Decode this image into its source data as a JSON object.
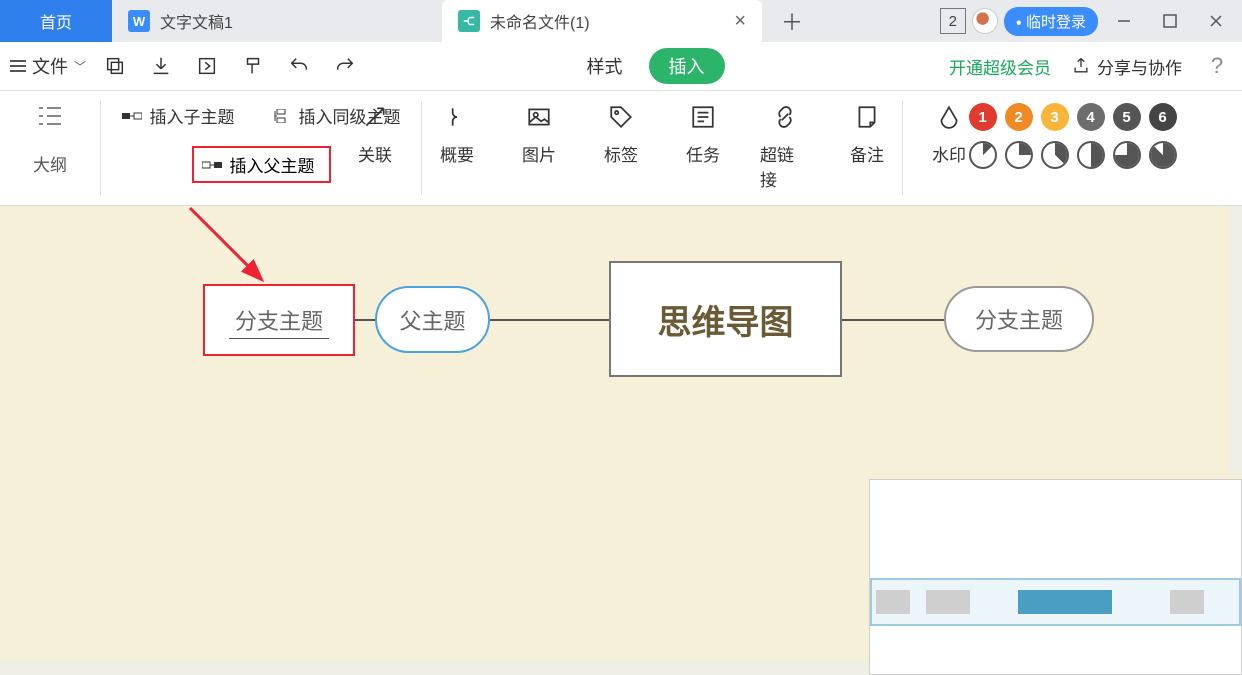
{
  "tabs": {
    "home": "首页",
    "doc": "文字文稿1",
    "file": "未命名文件(1)",
    "badge": "2",
    "login": "临时登录"
  },
  "menubar": {
    "file": "文件",
    "style": "样式",
    "insert": "插入",
    "vip": "开通超级会员",
    "share": "分享与协作",
    "help": "?"
  },
  "ribbon": {
    "outline": "大纲",
    "insert_sub": "插入子主题",
    "insert_peer": "插入同级主题",
    "insert_parent": "插入父主题",
    "tools": {
      "relation": "关联",
      "summary": "概要",
      "image": "图片",
      "tag": "标签",
      "task": "任务",
      "hyperlink": "超链接",
      "note": "备注",
      "watermark": "水印"
    },
    "numbers": [
      "1",
      "2",
      "3",
      "4",
      "5",
      "6"
    ]
  },
  "canvas": {
    "branch": "分支主题",
    "parent": "父主题",
    "center": "思维导图",
    "branch2": "分支主题"
  }
}
